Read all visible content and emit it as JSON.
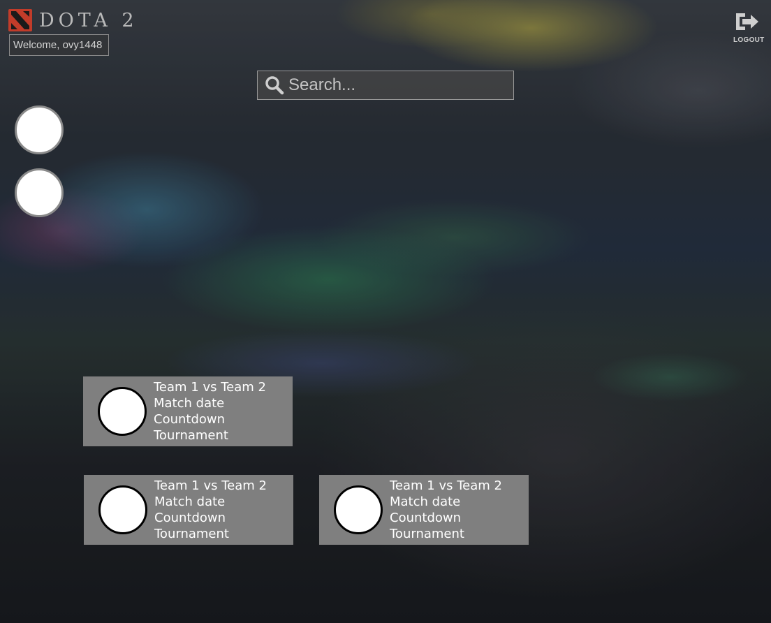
{
  "header": {
    "logo_text": "DOTA 2",
    "welcome_text": "Welcome, ovy1448",
    "logout_label": "LOGOUT"
  },
  "search": {
    "placeholder": "Search..."
  },
  "side_items": [
    {
      "name": "side-avatar-1"
    },
    {
      "name": "side-avatar-2"
    }
  ],
  "matches": [
    {
      "title": "Team 1 vs Team 2",
      "date": "Match date",
      "countdown": "Countdown",
      "tournament": "Tournament"
    },
    {
      "title": "Team 1 vs Team 2",
      "date": "Match date",
      "countdown": "Countdown",
      "tournament": "Tournament"
    },
    {
      "title": "Team 1 vs Team 2",
      "date": "Match date",
      "countdown": "Countdown",
      "tournament": "Tournament"
    }
  ],
  "colors": {
    "card_background": "#7f7f7f",
    "logo_red": "#c23c2a",
    "text": "#ffffff"
  },
  "icons": {
    "logo": "dota-logo-icon",
    "search": "search-icon",
    "logout": "logout-icon"
  }
}
